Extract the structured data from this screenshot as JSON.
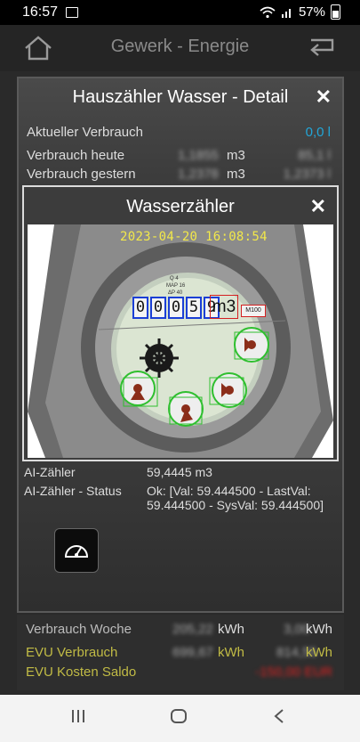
{
  "status": {
    "time": "16:57",
    "battery": "57%"
  },
  "topbar": {
    "title": "Gewerk - Energie"
  },
  "detail": {
    "title": "Hauszähler Wasser - Detail",
    "rows": [
      {
        "label": "Aktueller Verbrauch",
        "value2": "0,0 l"
      },
      {
        "label": "Verbrauch heute",
        "value": "1,1855",
        "unit": "m3",
        "value2": "85,1 l"
      },
      {
        "label": "Verbrauch gestern",
        "value": "1,2378",
        "unit": "m3",
        "value2": "1,2373 l"
      }
    ]
  },
  "modal": {
    "title": "Wasserzähler",
    "timestamp": "2023-04-20 16:08:54",
    "digits": [
      "0",
      "0",
      "0",
      "5",
      "9"
    ],
    "unit_mark": "m3",
    "dial_labels": [
      "M100"
    ]
  },
  "ai": {
    "rows": [
      {
        "label": "AI-Zähler",
        "value": "59,4445 m3"
      },
      {
        "label": "AI-Zähler - Status",
        "value": "Ok: [Val: 59.444500 - LastVal: 59.444500 - SysVal: 59.444500]"
      }
    ]
  },
  "bottom": {
    "rows": [
      {
        "label": "Verbrauch Woche",
        "value": "205,22",
        "unit": "kWh",
        "value2": "3,00",
        "unit2": "kWh"
      },
      {
        "label": "EVU Verbrauch",
        "value": "699,67",
        "unit": "kWh",
        "value2": "814,55",
        "unit2": "kWh"
      },
      {
        "label": "EVU Kosten Saldo",
        "value2": "-150,00 EUR"
      }
    ]
  }
}
